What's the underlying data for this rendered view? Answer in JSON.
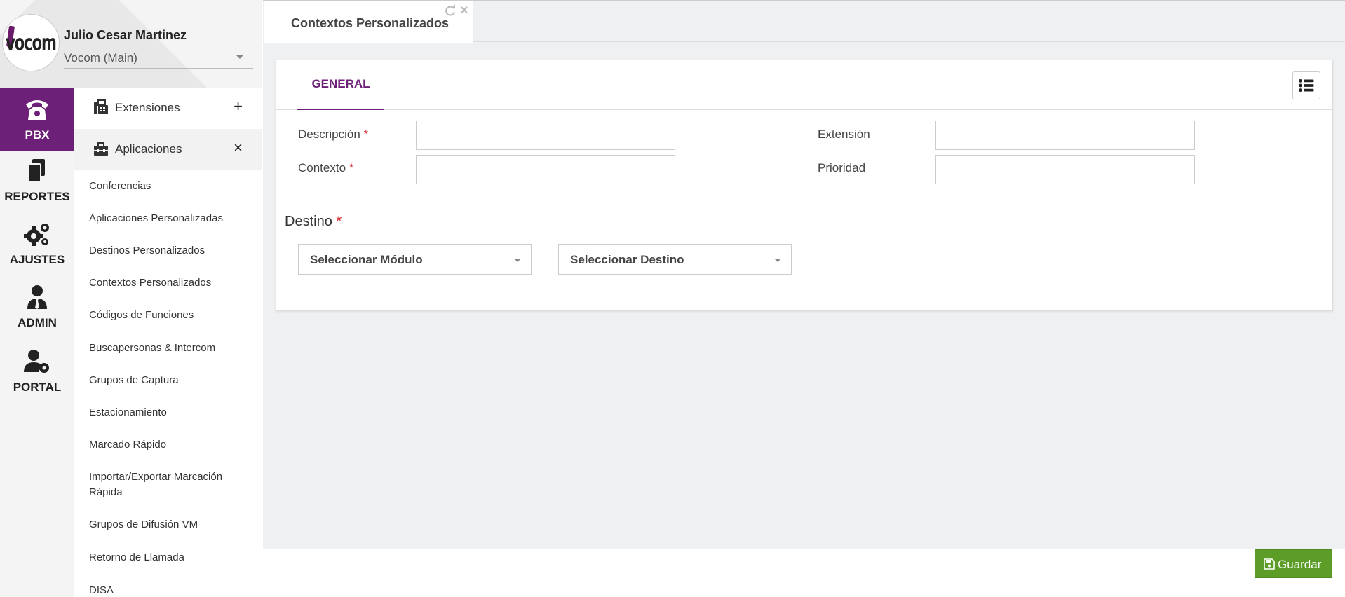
{
  "user": {
    "name": "Julio Cesar Martinez",
    "organization": "Vocom (Main)",
    "logo_text": "vocom"
  },
  "rail": {
    "items": [
      {
        "label": "PBX",
        "icon": "phone-icon",
        "active": true
      },
      {
        "label": "REPORTES",
        "icon": "documents-icon",
        "active": false
      },
      {
        "label": "AJUSTES",
        "icon": "gears-icon",
        "active": false
      },
      {
        "label": "ADMIN",
        "icon": "user-tie-icon",
        "active": false
      },
      {
        "label": "PORTAL",
        "icon": "user-gear-icon",
        "active": false
      }
    ],
    "active_color": "#6d2077"
  },
  "menu": {
    "sections": [
      {
        "label": "Extensiones",
        "icon": "fax-icon",
        "toggle": "+",
        "open": false
      },
      {
        "label": "Aplicaciones",
        "icon": "toolbox-icon",
        "toggle": "×",
        "open": true
      }
    ],
    "items": [
      "Conferencias",
      "Aplicaciones Personalizadas",
      "Destinos Personalizados",
      "Contextos Personalizados",
      "Códigos de Funciones",
      "Buscapersonas & Intercom",
      "Grupos de Captura",
      "Estacionamiento",
      "Marcado Rápido",
      "Importar/Exportar Marcación Rápida",
      "Grupos de Difusión VM",
      "Retorno de Llamada",
      "DISA"
    ]
  },
  "tabbar": {
    "title": "Contextos Personalizados",
    "refresh_icon": "refresh-icon",
    "close_label": "×"
  },
  "form": {
    "tab_general": "GENERAL",
    "list_icon": "list-icon",
    "fields": {
      "descripcion": {
        "label": "Descripción",
        "required": "*",
        "value": ""
      },
      "contexto": {
        "label": "Contexto",
        "required": "*",
        "value": ""
      },
      "extension": {
        "label": "Extensión",
        "value": ""
      },
      "prioridad": {
        "label": "Prioridad",
        "value": ""
      }
    },
    "destino": {
      "title": "Destino",
      "required": "*",
      "modulo_placeholder": "Seleccionar Módulo",
      "destino_placeholder": "Seleccionar Destino"
    }
  },
  "footer": {
    "save_label": "Guardar",
    "save_icon": "floppy-icon",
    "save_color": "#5b9d27"
  }
}
